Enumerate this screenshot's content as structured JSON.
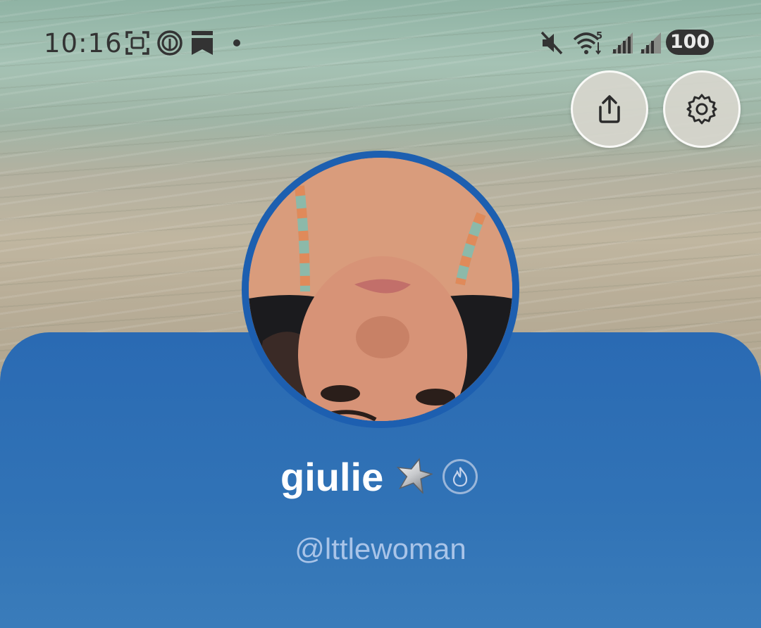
{
  "status_bar": {
    "time": "10:16",
    "battery": "100",
    "network_badge": "5",
    "icons": [
      "screenshot-icon",
      "threads-icon",
      "bookmark-icon",
      "notification-dot",
      "mute-icon",
      "wifi-icon",
      "signal-icon",
      "signal-icon-2",
      "battery-icon"
    ]
  },
  "actions": {
    "share_icon": "share-upload-icon",
    "settings_icon": "gear-icon"
  },
  "profile": {
    "display_name": "giulie",
    "badges": [
      "star-badge-icon",
      "fire-badge-icon"
    ],
    "username": "@lttlewoman"
  },
  "colors": {
    "panel_blue": "#2a6ab3",
    "avatar_ring": "#1d5fb0",
    "username_text": "#a9c4e8"
  }
}
